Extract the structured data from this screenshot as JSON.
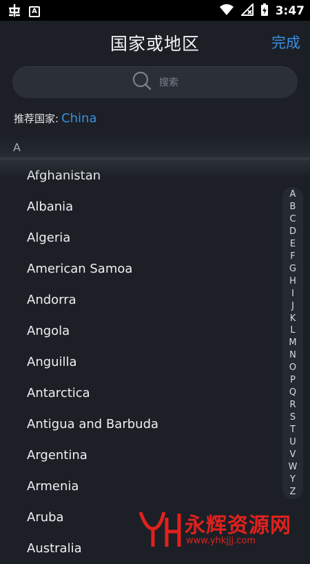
{
  "status_bar": {
    "time": "3:47",
    "left_icons": [
      "bug-icon",
      "app-a-icon"
    ],
    "right_icons": [
      "wifi-icon",
      "signal-off-icon",
      "battery-charging-icon"
    ]
  },
  "header": {
    "title": "国家或地区",
    "done_label": "完成"
  },
  "search": {
    "placeholder": "搜索",
    "icon": "search-icon"
  },
  "recommended": {
    "label": "推荐国家:",
    "value": "China"
  },
  "section": {
    "letter": "A"
  },
  "countries": [
    "Afghanistan",
    "Albania",
    "Algeria",
    "American Samoa",
    "Andorra",
    "Angola",
    "Anguilla",
    "Antarctica",
    "Antigua and Barbuda",
    "Argentina",
    "Armenia",
    "Aruba",
    "Australia"
  ],
  "index_letters": [
    "A",
    "B",
    "C",
    "D",
    "E",
    "F",
    "G",
    "H",
    "I",
    "J",
    "K",
    "L",
    "M",
    "N",
    "O",
    "P",
    "Q",
    "R",
    "S",
    "T",
    "U",
    "V",
    "W",
    "Y",
    "Z"
  ],
  "watermark": {
    "text": "永辉资源网",
    "url": "www.yhkjjj.com",
    "logo": "YH"
  },
  "colors": {
    "background": "#1c2026",
    "accent": "#3a8fe0",
    "watermark": "#e0211d"
  }
}
